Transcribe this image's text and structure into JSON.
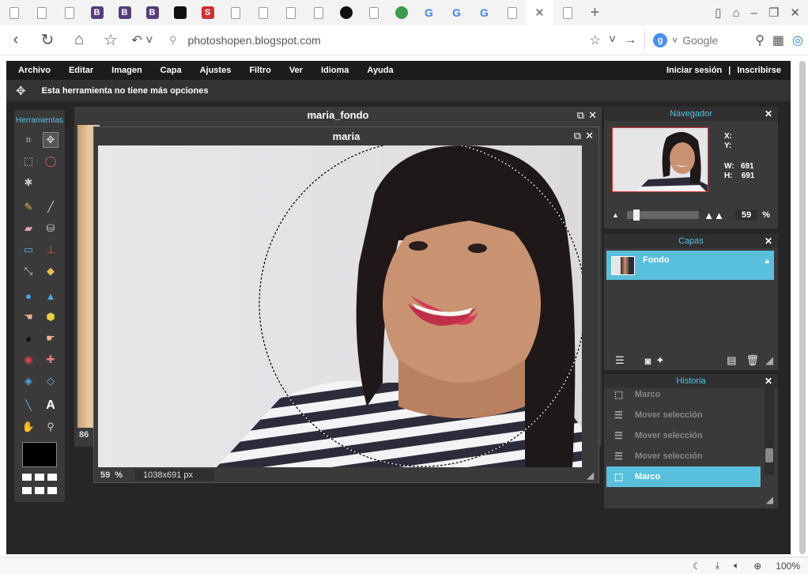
{
  "browser": {
    "url": "photoshopen.blogspot.com",
    "search_placeholder": "Google",
    "zoom": "100%",
    "tabs": [
      {
        "icon": "page-icon"
      },
      {
        "icon": "page-icon"
      },
      {
        "icon": "page-icon"
      },
      {
        "icon": "bootstrap-icon",
        "letter": "B",
        "color": "#563d7c"
      },
      {
        "icon": "bootstrap-icon",
        "letter": "B",
        "color": "#563d7c"
      },
      {
        "icon": "bootstrap-icon",
        "letter": "B",
        "color": "#563d7c"
      },
      {
        "icon": "flag-icon",
        "color": "#111111"
      },
      {
        "icon": "s-icon",
        "letter": "S",
        "color": "#cc3333"
      },
      {
        "icon": "page-icon"
      },
      {
        "icon": "page-icon"
      },
      {
        "icon": "page-icon"
      },
      {
        "icon": "page-icon"
      },
      {
        "icon": "github-icon",
        "color": "#111111"
      },
      {
        "icon": "page-icon"
      },
      {
        "icon": "globe-icon",
        "color": "#3a9d4a"
      },
      {
        "icon": "google-icon",
        "letter": "G",
        "color": "#4285f4"
      },
      {
        "icon": "google-icon",
        "letter": "G",
        "color": "#4285f4"
      },
      {
        "icon": "google-icon",
        "letter": "G",
        "color": "#4285f4"
      },
      {
        "icon": "page-icon"
      },
      {
        "icon": "close-icon",
        "active": true
      },
      {
        "icon": "page-icon"
      }
    ]
  },
  "menu": {
    "items": [
      "Archivo",
      "Editar",
      "Imagen",
      "Capa",
      "Ajustes",
      "Filtro",
      "Ver",
      "Idioma",
      "Ayuda"
    ],
    "login": "Iniciar sesión",
    "separator": "|",
    "signup": "Inscribirse"
  },
  "options_bar": {
    "text": "Esta herramienta no tiene más opciones"
  },
  "tools": {
    "title": "Herramientas"
  },
  "documents": {
    "background": {
      "title": "maria_fondo",
      "zoom": "86"
    },
    "foreground": {
      "title": "maria",
      "zoom": "59",
      "zoom_unit": "%",
      "size": "1038x691 px"
    }
  },
  "navigator": {
    "title": "Navegador",
    "x_label": "X:",
    "y_label": "Y:",
    "w_label": "W:",
    "w_value": "691",
    "h_label": "H:",
    "h_value": "691",
    "zoom": "59",
    "zoom_unit": "%"
  },
  "layers": {
    "title": "Capas",
    "items": [
      {
        "name": "Fondo"
      }
    ]
  },
  "history": {
    "title": "Historia",
    "items": [
      "Marco",
      "Mover selección",
      "Mover selección",
      "Mover selección",
      "Marco"
    ]
  },
  "colors": {
    "accent": "#58c0dc",
    "panel": "#3a3a3a",
    "app_bg": "#262626"
  }
}
